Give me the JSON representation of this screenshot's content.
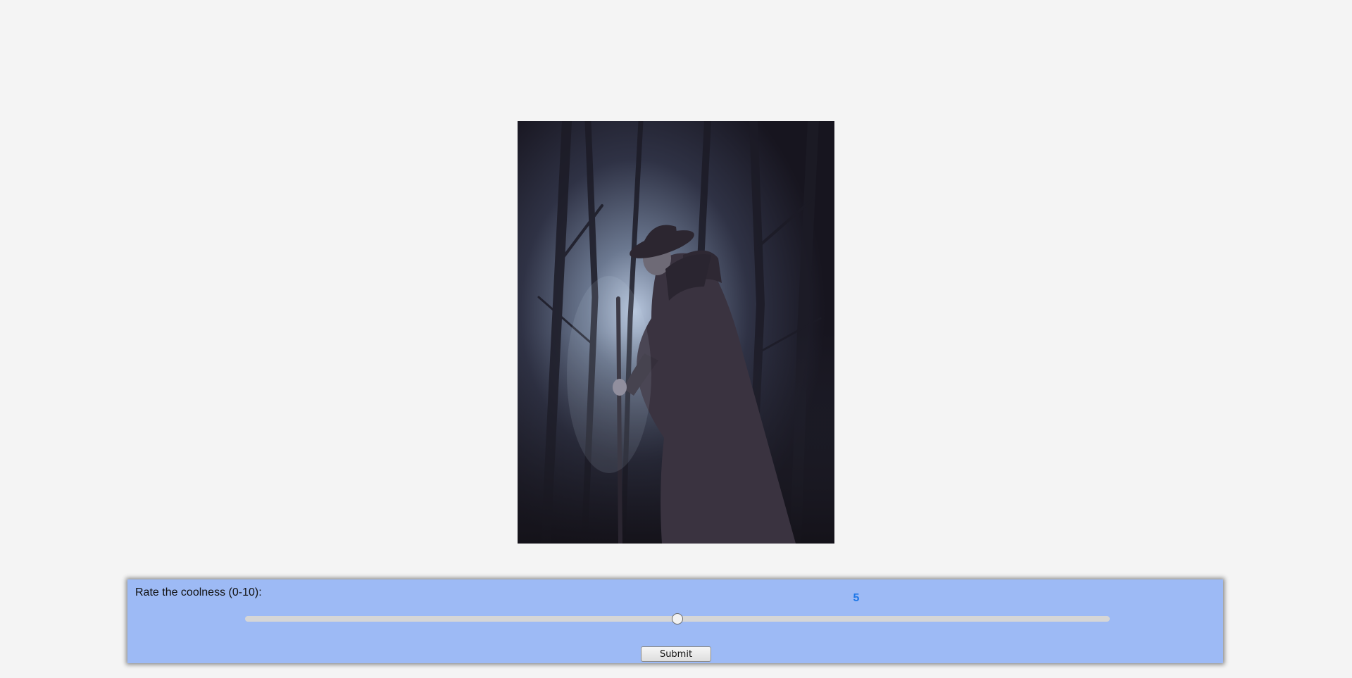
{
  "image": {
    "alt": "",
    "icon": "forest-wanderer-image"
  },
  "rating": {
    "label": "Rate the coolness (0-10):",
    "min": 0,
    "max": 10,
    "value": 5,
    "value_display": "5",
    "value_color": "#1f78e8"
  },
  "form": {
    "submit_label": "Submit"
  },
  "colors": {
    "panel_bg": "#9dbaf5",
    "page_bg": "#f4f4f4"
  }
}
